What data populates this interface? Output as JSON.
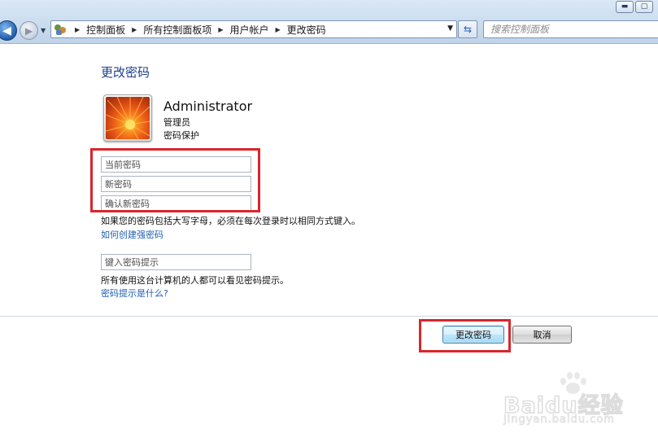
{
  "window": {
    "controls": {
      "minimize_icon": "minimize-icon",
      "maximize_icon": "maximize-icon"
    }
  },
  "nav": {
    "breadcrumb": [
      "控制面板",
      "所有控制面板项",
      "用户帐户",
      "更改密码"
    ],
    "search_placeholder": "搜索控制面板"
  },
  "page": {
    "title": "更改密码",
    "user": {
      "name": "Administrator",
      "role": "管理员",
      "protection": "密码保护"
    },
    "fields": {
      "current_password": "当前密码",
      "new_password": "新密码",
      "confirm_password": "确认新密码",
      "password_hint": "键入密码提示"
    },
    "note_case": "如果您的密码包括大写字母，必须在每次登录时以相同方式键入。",
    "link_strong_password": "如何创建强密码",
    "note_hint_visible": "所有使用这台计算机的人都可以看见密码提示。",
    "link_what_hint": "密码提示是什么?",
    "buttons": {
      "change_password": "更改密码",
      "cancel": "取消"
    }
  },
  "watermark": {
    "logo": "Baidu经验",
    "url": "jingyan.baidu.com"
  },
  "colors": {
    "title_blue": "#1e3f8c",
    "link_blue": "#1f5fb3",
    "highlight_red": "#d9262b"
  }
}
